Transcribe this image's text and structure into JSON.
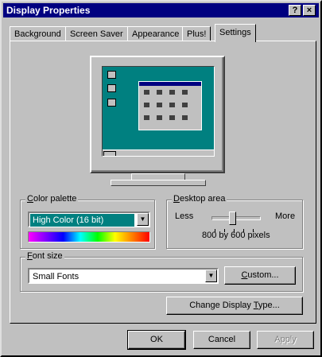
{
  "window": {
    "title": "Display Properties",
    "help_glyph": "?",
    "close_glyph": "×"
  },
  "tabs": [
    {
      "label": "Background",
      "active": false
    },
    {
      "label": "Screen Saver",
      "active": false
    },
    {
      "label": "Appearance",
      "active": false
    },
    {
      "label": "Plus!",
      "active": false
    },
    {
      "label": "Settings",
      "active": true
    }
  ],
  "color_palette": {
    "label_key": "C",
    "label_rest": "olor palette",
    "value": "High Color (16 bit)"
  },
  "desktop_area": {
    "label_key": "D",
    "label_rest": "esktop area",
    "less": "Less",
    "more": "More",
    "resolution": "800 by 600 pixels",
    "slider_position": 0.43
  },
  "font_size": {
    "label_key": "F",
    "label_rest": "ont size",
    "value": "Small Fonts",
    "custom_key": "C",
    "custom_pre": "",
    "custom_label_full": "Custom...",
    "custom_rest": "ustom..."
  },
  "change_display": {
    "pre": "Change Display ",
    "key": "T",
    "rest": "ype..."
  },
  "buttons": {
    "ok": "OK",
    "cancel": "Cancel",
    "apply": "Apply"
  },
  "icons": {
    "arrow": "▼",
    "monitor": "monitor-preview-icon"
  },
  "colors": {
    "titlebar": "#000080",
    "face": "#c0c0c0",
    "desktop": "#008080"
  }
}
